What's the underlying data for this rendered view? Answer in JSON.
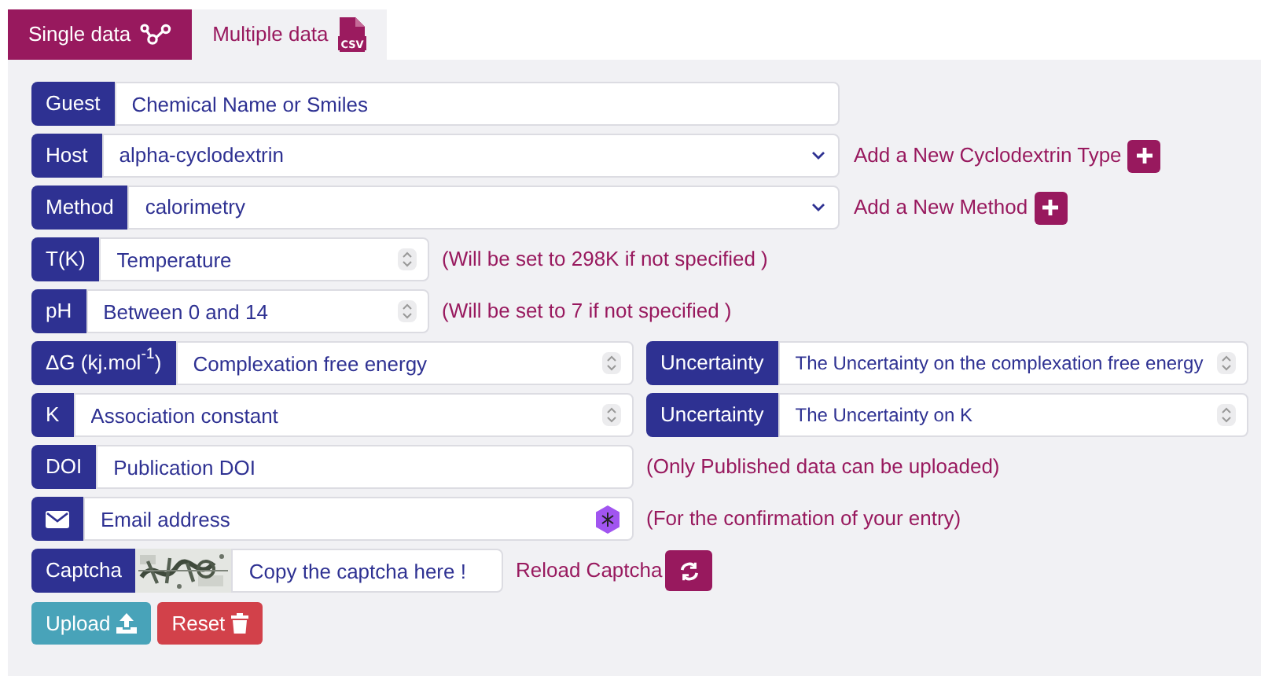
{
  "tabs": [
    {
      "label": "Single data",
      "selected": true
    },
    {
      "label": "Multiple data",
      "selected": false,
      "file_badge": "CSV"
    }
  ],
  "rows": [
    {
      "kind": "text",
      "label": "Guest",
      "placeholder": "Chemical Name or Smiles"
    },
    {
      "kind": "select",
      "label": "Host",
      "value": "alpha-cyclodextrin",
      "add_label": "Add a New Cyclodextrin Type"
    },
    {
      "kind": "select",
      "label": "Method",
      "value": "calorimetry",
      "add_label": "Add a New Method"
    },
    {
      "kind": "number",
      "label": "T(K)",
      "placeholder": "Temperature",
      "note": "(Will be set to 298K if not specified )"
    },
    {
      "kind": "number",
      "label": "pH",
      "placeholder": "Between 0 and 14",
      "note": "(Will be set to 7 if not specified )"
    },
    {
      "kind": "number",
      "label": "ΔG (kj.mol$^{-1}$)",
      "placeholder": "Complexation free energy",
      "second": {
        "label": "Uncertainty",
        "placeholder": "The Uncertainty on the complexation free energy"
      }
    },
    {
      "kind": "number",
      "label": "K",
      "placeholder": "Association constant",
      "second": {
        "label": "Uncertainty",
        "placeholder": "The Uncertainty on K"
      }
    },
    {
      "kind": "text",
      "label": "DOI",
      "placeholder": "Publication DOI",
      "note": "(Only Published data can be uploaded)"
    },
    {
      "kind": "email",
      "placeholder": "Email address",
      "note": "(For the confirmation of your entry)"
    },
    {
      "kind": "captcha",
      "label": "Captcha",
      "placeholder": "Copy the captcha here !",
      "reload_label": "Reload Captcha"
    }
  ],
  "buttons": [
    {
      "kind": "upload",
      "label": "Upload"
    },
    {
      "kind": "reset",
      "label": "Reset"
    }
  ]
}
